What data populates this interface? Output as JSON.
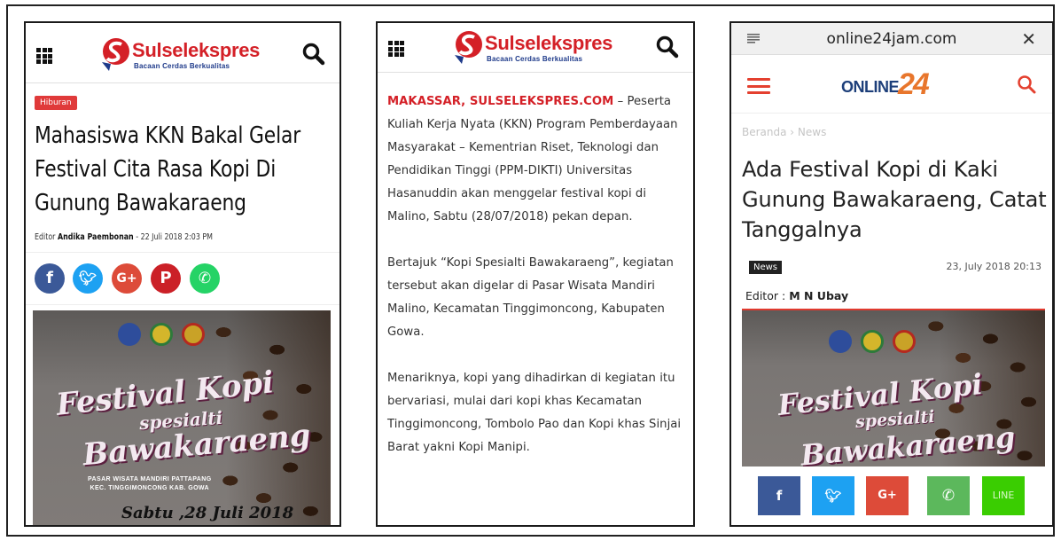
{
  "phone1": {
    "brand": {
      "name": "Sulselekspres",
      "tagline": "Bacaan Cerdas Berkualitas"
    },
    "category": "Hiburan",
    "headline": "Mahasiswa KKN Bakal Gelar Festival Cita Rasa Kopi Di Gunung Bawakaraeng",
    "byline_prefix": "Editor",
    "byline_author": "Andika Paembonan",
    "byline_sep": " -  ",
    "byline_date": "22 Juli 2018 2:03 PM",
    "share": [
      {
        "icon": "facebook-icon",
        "glyph": "f",
        "color": "#3b5998"
      },
      {
        "icon": "twitter-icon",
        "glyph": "t",
        "color": "#1da1f2"
      },
      {
        "icon": "google-plus-icon",
        "glyph": "G+",
        "color": "#dd4b39"
      },
      {
        "icon": "pinterest-icon",
        "glyph": "P",
        "color": "#cb2027"
      },
      {
        "icon": "whatsapp-icon",
        "glyph": "✆",
        "color": "#25d366"
      }
    ],
    "poster": {
      "title": "Festival Kopi",
      "subtitle": "spesialti",
      "name": "Bawakaraeng",
      "place_line1": "PASAR WISATA MANDIRI PATTAPANG",
      "place_line2": "KEC. TINGGIMONCONG KAB. GOWA",
      "date": "Sabtu ,28 Juli 2018"
    }
  },
  "phone2": {
    "dateline": "MAKASSAR, SULSELEKSPRES.COM",
    "paragraphs": [
      "– Peserta Kuliah Kerja Nyata (KKN) Program Pemberdayaan Masyarakat – Kementrian Riset, Teknologi dan Pendidikan Tinggi (PPM-DIKTI) Universitas Hasanuddin akan menggelar festival kopi di Malino, Sabtu (28/07/2018) pekan depan.",
      "Bertajuk “Kopi Spesialti Bawakaraeng”, kegiatan tersebut akan digelar di Pasar Wisata Mandiri Malino, Kecamatan Tinggimoncong, Kabupaten Gowa.",
      "Menariknya, kopi yang dihadirkan di kegiatan itu bervariasi, mulai dari kopi khas Kecamatan Tinggimoncong, Tombolo Pao dan Kopi khas Sinjai Barat yakni Kopi Manipi."
    ]
  },
  "phone3": {
    "url": "online24jam.com",
    "close": "✕",
    "brand_text": "ONLINE",
    "brand_num": "24",
    "breadcrumb": "Beranda  ›  News",
    "headline": "Ada Festival Kopi di Kaki Gunung Bawakaraeng, Catat Tanggalnya",
    "tag": "News",
    "date": "23, July 2018 20:13",
    "editor_label": "Editor :",
    "editor_name": "M N Ubay",
    "share": [
      {
        "icon": "facebook-icon",
        "glyph": "f",
        "color": "#3b5998"
      },
      {
        "icon": "twitter-icon",
        "glyph": "t",
        "color": "#1da1f2"
      },
      {
        "icon": "google-plus-icon",
        "glyph": "G+",
        "color": "#dd4b39"
      },
      {
        "icon": "whatsapp-icon",
        "glyph": "✆",
        "color": "#5cb85c"
      },
      {
        "icon": "line-icon",
        "glyph": "LINE",
        "color": "#3acd01"
      }
    ]
  },
  "colors": {
    "brand_red": "#d42027",
    "brand_blue": "#1e3a8a",
    "online_orange": "#e8762c"
  }
}
